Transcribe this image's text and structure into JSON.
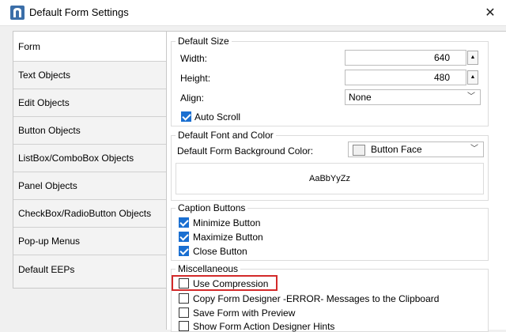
{
  "window": {
    "title": "Default Form Settings",
    "icon": "app-icon",
    "close_icon": "close-icon"
  },
  "sidebar": {
    "items": [
      {
        "label": "Form",
        "active": true
      },
      {
        "label": "Text Objects"
      },
      {
        "label": "Edit Objects"
      },
      {
        "label": "Button Objects"
      },
      {
        "label": "ListBox/ComboBox Objects"
      },
      {
        "label": "Panel Objects"
      },
      {
        "label": "CheckBox/RadioButton Objects"
      },
      {
        "label": "Pop-up Menus"
      },
      {
        "label": "Default EEPs"
      }
    ]
  },
  "default_size": {
    "title": "Default Size",
    "width_label": "Width:",
    "width_value": "640",
    "height_label": "Height:",
    "height_value": "480",
    "align_label": "Align:",
    "align_value": "None",
    "auto_scroll_label": "Auto Scroll",
    "auto_scroll_checked": true
  },
  "font_color": {
    "title": "Default Font and Color",
    "bg_color_label": "Default Form Background Color:",
    "bg_color_value": "Button Face",
    "preview_text": "AaBbYyZz"
  },
  "caption_buttons": {
    "title": "Caption Buttons",
    "items": [
      {
        "label": "Minimize Button",
        "checked": true
      },
      {
        "label": "Maximize Button",
        "checked": true
      },
      {
        "label": "Close Button",
        "checked": true
      }
    ]
  },
  "misc": {
    "title": "Miscellaneous",
    "items": [
      {
        "label": "Use Compression",
        "checked": false
      },
      {
        "label": "Copy Form Designer -ERROR- Messages to the Clipboard",
        "checked": false
      },
      {
        "label": "Save Form with Preview",
        "checked": false
      },
      {
        "label": "Show Form Action Designer Hints",
        "checked": false
      }
    ]
  },
  "colors": {
    "accent": "#1a6fd1",
    "highlight": "#d32a2a"
  }
}
